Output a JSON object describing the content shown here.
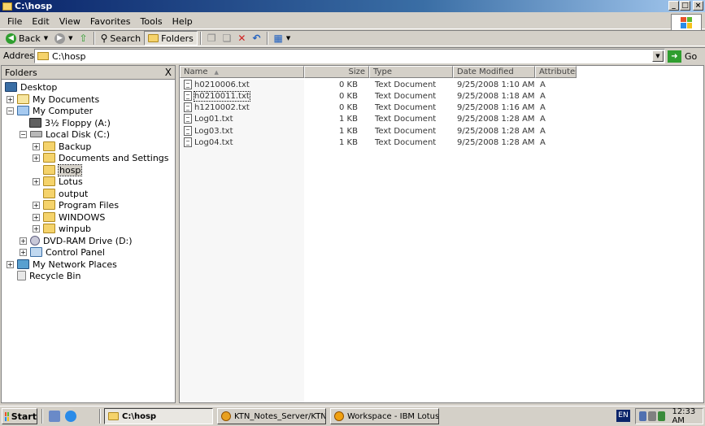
{
  "window": {
    "title": "C:\\hosp",
    "minimize": "_",
    "maximize": "□",
    "close": "×"
  },
  "menu": [
    "File",
    "Edit",
    "View",
    "Favorites",
    "Tools",
    "Help"
  ],
  "toolbar": {
    "back": "Back",
    "search": "Search",
    "folders": "Folders"
  },
  "address": {
    "label": "Address",
    "value": "C:\\hosp",
    "go": "Go"
  },
  "folders_pane": {
    "title": "Folders",
    "close": "X",
    "tree": [
      {
        "label": "Desktop",
        "icon": "desktop-icon",
        "expander": ""
      },
      {
        "label": "My Documents",
        "icon": "my-documents-icon",
        "expander": "+"
      },
      {
        "label": "My Computer",
        "icon": "my-computer-icon",
        "expander": "−"
      },
      {
        "label": "3½ Floppy (A:)",
        "icon": "floppy-icon",
        "expander": ""
      },
      {
        "label": "Local Disk (C:)",
        "icon": "local-disk-icon",
        "expander": "−"
      },
      {
        "label": "Backup",
        "icon": "folder-icon",
        "expander": "+"
      },
      {
        "label": "Documents and Settings",
        "icon": "folder-icon",
        "expander": "+"
      },
      {
        "label": "hosp",
        "icon": "folder-open-icon",
        "expander": "",
        "selected": true
      },
      {
        "label": "Lotus",
        "icon": "folder-icon",
        "expander": "+"
      },
      {
        "label": "output",
        "icon": "folder-icon",
        "expander": ""
      },
      {
        "label": "Program Files",
        "icon": "folder-icon",
        "expander": "+"
      },
      {
        "label": "WINDOWS",
        "icon": "folder-icon",
        "expander": "+"
      },
      {
        "label": "winpub",
        "icon": "folder-icon",
        "expander": "+"
      },
      {
        "label": "DVD-RAM Drive (D:)",
        "icon": "dvd-drive-icon",
        "expander": "+"
      },
      {
        "label": "Control Panel",
        "icon": "control-panel-icon",
        "expander": "+"
      },
      {
        "label": "My Network Places",
        "icon": "network-places-icon",
        "expander": "+"
      },
      {
        "label": "Recycle Bin",
        "icon": "recycle-bin-icon",
        "expander": ""
      }
    ]
  },
  "file_list": {
    "columns": [
      "Name",
      "Size",
      "Type",
      "Date Modified",
      "Attributes"
    ],
    "sort_column": "Name",
    "rows": [
      {
        "name": "h0210006.txt",
        "size": "0 KB",
        "type": "Text Document",
        "modified": "9/25/2008 1:10 AM",
        "attr": "A"
      },
      {
        "name": "h0210011.txt",
        "size": "0 KB",
        "type": "Text Document",
        "modified": "9/25/2008 1:18 AM",
        "attr": "A",
        "focused": true
      },
      {
        "name": "h1210002.txt",
        "size": "0 KB",
        "type": "Text Document",
        "modified": "9/25/2008 1:16 AM",
        "attr": "A"
      },
      {
        "name": "Log01.txt",
        "size": "1 KB",
        "type": "Text Document",
        "modified": "9/25/2008 1:28 AM",
        "attr": "A"
      },
      {
        "name": "Log03.txt",
        "size": "1 KB",
        "type": "Text Document",
        "modified": "9/25/2008 1:28 AM",
        "attr": "A"
      },
      {
        "name": "Log04.txt",
        "size": "1 KB",
        "type": "Text Document",
        "modified": "9/25/2008 1:28 AM",
        "attr": "A"
      }
    ]
  },
  "taskbar": {
    "start": "Start",
    "tasks": [
      {
        "label": "C:\\hosp",
        "active": true
      },
      {
        "label": "KTN_Notes_Server/KTNB...",
        "active": false
      },
      {
        "label": "Workspace - IBM Lotus N...",
        "active": false
      }
    ],
    "language": "EN",
    "clock": "12:33 AM"
  },
  "colors": {
    "title_bar": "#0a246a",
    "face": "#d4d0c8",
    "folder": "#f5d36b"
  }
}
